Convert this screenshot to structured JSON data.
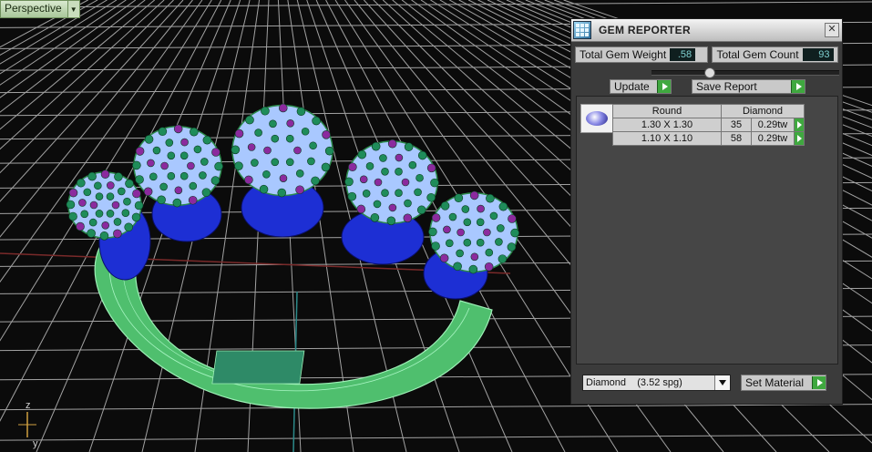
{
  "viewport": {
    "mode_label": "Perspective"
  },
  "gem_reporter": {
    "title": "GEM REPORTER",
    "close_glyph": "✕",
    "total_gem_weight_label": "Total Gem Weight",
    "total_gem_weight_value": ".58",
    "total_gem_count_label": "Total Gem Count",
    "total_gem_count_value": "93",
    "update_label": "Update",
    "save_report_label": "Save Report",
    "table": {
      "header": [
        "Round",
        "Diamond"
      ],
      "rows": [
        {
          "size": "1.30 X 1.30",
          "count": "35",
          "weight": "0.29tw"
        },
        {
          "size": "1.10 X 1.10",
          "count": "58",
          "weight": "0.29tw"
        }
      ]
    },
    "material_select": "Diamond    (3.52 spg)",
    "set_material_label": "Set Material"
  },
  "axis_labels": {
    "z": "z",
    "y": "y"
  },
  "colors": {
    "ring_green": "#55d27a",
    "gem_face": "#a9c8ff",
    "prong_green": "#1f8c5a",
    "prong_purple": "#8b2a9e",
    "gem_blue": "#1d2fd4",
    "grid": "#cfcfcf"
  }
}
